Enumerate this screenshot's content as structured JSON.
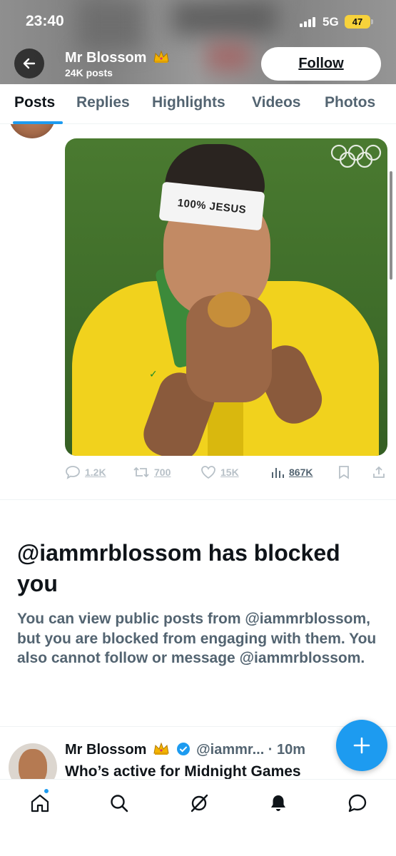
{
  "status_bar": {
    "time": "23:40",
    "network": "5G",
    "battery": "47"
  },
  "header": {
    "profile_name": "Mr Blossom",
    "crown_emoji": "👑",
    "post_count": "24K posts",
    "follow_label": "Follow",
    "back_icon": "back-arrow-icon"
  },
  "tabs": [
    {
      "label": "Posts",
      "active": true
    },
    {
      "label": "Replies"
    },
    {
      "label": "Highlights"
    },
    {
      "label": "Videos"
    },
    {
      "label": "Photos"
    }
  ],
  "post": {
    "media_text": "100% JESUS",
    "stats": {
      "replies": "1.2K",
      "reposts": "700",
      "likes": "15K",
      "views": "867K"
    }
  },
  "blocked": {
    "title": "@iammrblossom has blocked you",
    "body": "You can view public posts from @iammrblossom, but you are blocked from engaging with them. You also cannot follow or message @iammrblossom."
  },
  "post2": {
    "name": "Mr Blossom",
    "crown_emoji": "👑",
    "handle_time": "@iammr... · 10m",
    "text": "Who’s active for Midnight Games"
  },
  "bottom_nav": [
    "home-icon",
    "search-icon",
    "grok-icon",
    "notifications-icon",
    "messages-icon"
  ],
  "colors": {
    "accent": "#1d9bf0",
    "text": "#0f1419",
    "secondary": "#536471"
  }
}
